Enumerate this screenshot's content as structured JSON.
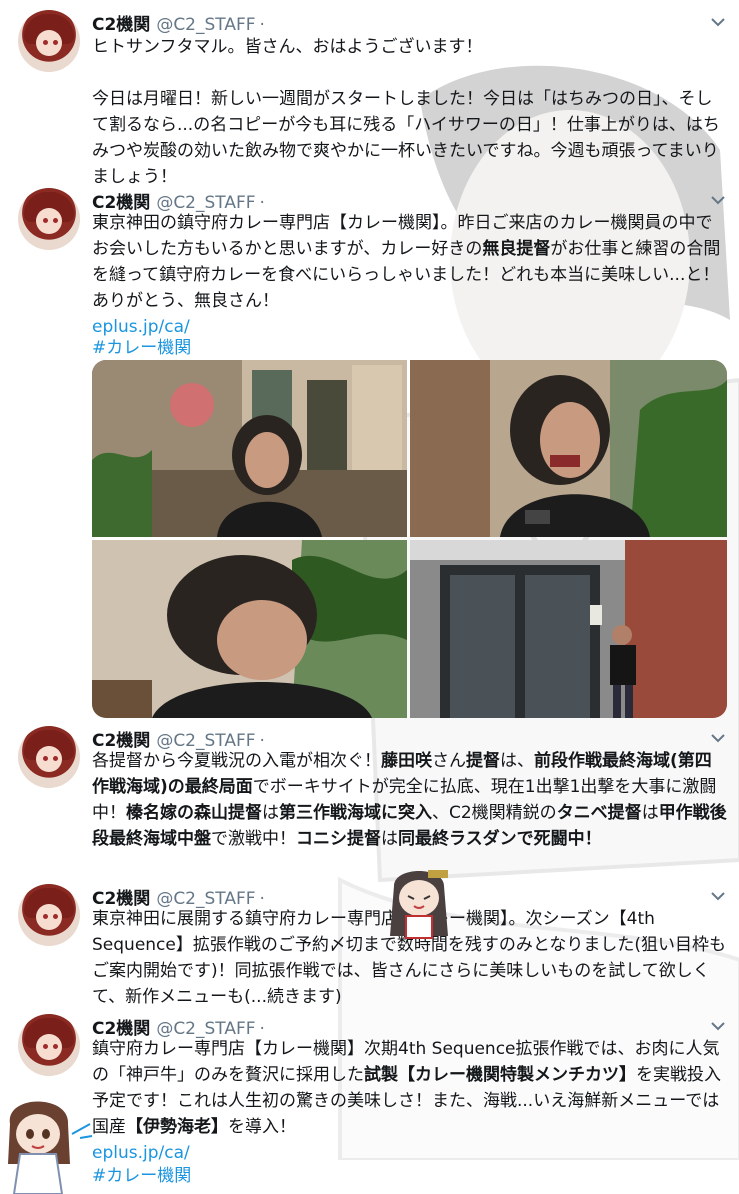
{
  "tweets": [
    {
      "name": "C2機関",
      "handle": "@C2_STAFF",
      "dot": "·",
      "text": "ヒトサンフタマル。皆さん、おはようございます！\n\n今日は月曜日！新しい一週間がスタートしました！今日は「はちみつの日」、そして割るなら...の名コピーが今も耳に残る「ハイサワーの日」！仕事上がりは、はちみつや炭酸の効いた飲み物で爽やかに一杯いきたいですね。今週も頑張ってまいりましょう！"
    },
    {
      "name": "C2機関",
      "handle": "@C2_STAFF",
      "dot": "·",
      "text_parts": [
        "東京神田の鎮守府カレー専門店【カレー機関】。昨日ご来店のカレー機関員の中でお会いした方もいるかと思いますが、カレー好きの",
        "無良提督",
        "がお仕事と練習の合間を縫って鎮守府カレーを食べにいらっしゃいました！どれも本当に美味しい...と！ありがとう、無良さん！"
      ],
      "link": "eplus.jp/ca/",
      "hashtag": "#カレー機関"
    },
    {
      "name": "C2機関",
      "handle": "@C2_STAFF",
      "dot": "·",
      "text_parts": [
        "各提督から今夏戦況の入電が相次ぐ！",
        "藤田咲",
        "さん",
        "提督",
        "は、",
        "前段作戦最終海域(第四作戦海域)の最終局面",
        "でボーキサイトが完全に払底、現在1出撃1出撃を大事に激闘中！",
        "榛名嫁の森山提督",
        "は",
        "第三作戦海域に突入",
        "、C2機関精鋭の",
        "タニベ提督",
        "は",
        "甲作戦後段最終海域中盤",
        "で激戦中！",
        "コニシ提督",
        "は",
        "同最終ラスダンで死闘中！"
      ]
    },
    {
      "name": "C2機関",
      "handle": "@C2_STAFF",
      "dot": "·",
      "text": "東京神田に展開する鎮守府カレー専門店【カレー機関】。次シーズン【4th Sequence】拡張作戦のご予約〆切まで数時間を残すのみとなりました(狙い目枠もご案内開始です)！同拡張作戦では、皆さんにさらに美味しいものを試して欲しくて、新作メニューも(...続きます)"
    },
    {
      "name": "C2機関",
      "handle": "@C2_STAFF",
      "dot": "·",
      "text_parts": [
        "鎮守府カレー専門店【カレー機関】次期4th Sequence拡張作戦では、お肉に人気の「神戸牛」のみを贅沢に採用した",
        "試製【カレー機関特製メンチカツ】",
        "を実戦投入予定です！これは人生初の驚きの美味しさ！また、海戦...いえ海鮮新メニューでは国産",
        "【伊勢海老】",
        "を導入！"
      ],
      "link": "eplus.jp/ca/",
      "hashtag": "#カレー機関"
    }
  ],
  "colors": {
    "link": "#1b95e0",
    "muted": "#657786",
    "text": "#14171a"
  }
}
